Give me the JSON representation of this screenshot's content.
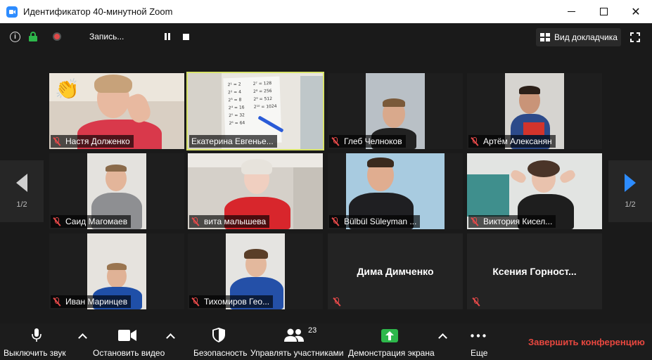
{
  "window": {
    "title": "Идентификатор 40-минутной Zoom",
    "minimize": "",
    "maximize": "",
    "close": "✕"
  },
  "topbar": {
    "info_icon": "i",
    "recording_label": "Запись...",
    "speaker_view_label": "Вид докладчика"
  },
  "pager": {
    "left_page": "1/2",
    "right_page": "1/2"
  },
  "participants": [
    {
      "name": "Настя Долженко",
      "muted": true,
      "video": true,
      "reaction": "👏"
    },
    {
      "name": "Екатерина  Евгенье...",
      "muted": false,
      "video": true,
      "active_speaker": true
    },
    {
      "name": "Глеб Челноков",
      "muted": true,
      "video": true
    },
    {
      "name": "Артём Алексанян",
      "muted": true,
      "video": true
    },
    {
      "name": "Саид Магомаев",
      "muted": true,
      "video": true
    },
    {
      "name": "вита малышева",
      "muted": true,
      "video": true
    },
    {
      "name": "Bülbül Süleyman ...",
      "muted": true,
      "video": true
    },
    {
      "name": "Виктория Кисел...",
      "muted": true,
      "video": true
    },
    {
      "name": "Иван Маринцев",
      "muted": true,
      "video": true
    },
    {
      "name": "Тихомиров Гео...",
      "muted": true,
      "video": true
    },
    {
      "name": "Дима Димченко",
      "muted": true,
      "video": false
    },
    {
      "name": "Ксения  Горност...",
      "muted": true,
      "video": false
    }
  ],
  "whiteboard": {
    "lines": [
      "2¹ = 2",
      "2² = 4",
      "2³ = 8",
      "2⁴ = 16",
      "2⁵ = 32",
      "2⁶ = 64",
      "2⁷ = 128",
      "2⁸ = 256",
      "2⁹ = 512",
      "2¹⁰ = 1024"
    ]
  },
  "toolbar": {
    "mute_label": "Выключить звук",
    "video_label": "Остановить видео",
    "security_label": "Безопасность",
    "participants_label": "Управлять участниками",
    "participants_count": "23",
    "share_label": "Демонстрация экрана",
    "more_label": "Еще",
    "end_label": "Завершить конференцию"
  },
  "colors": {
    "accent": "#2d8cff",
    "active_speaker_border": "#d8e36a",
    "end_button": "#e8473f",
    "share_green": "#2db84b",
    "muted_red": "#e84a4a"
  }
}
